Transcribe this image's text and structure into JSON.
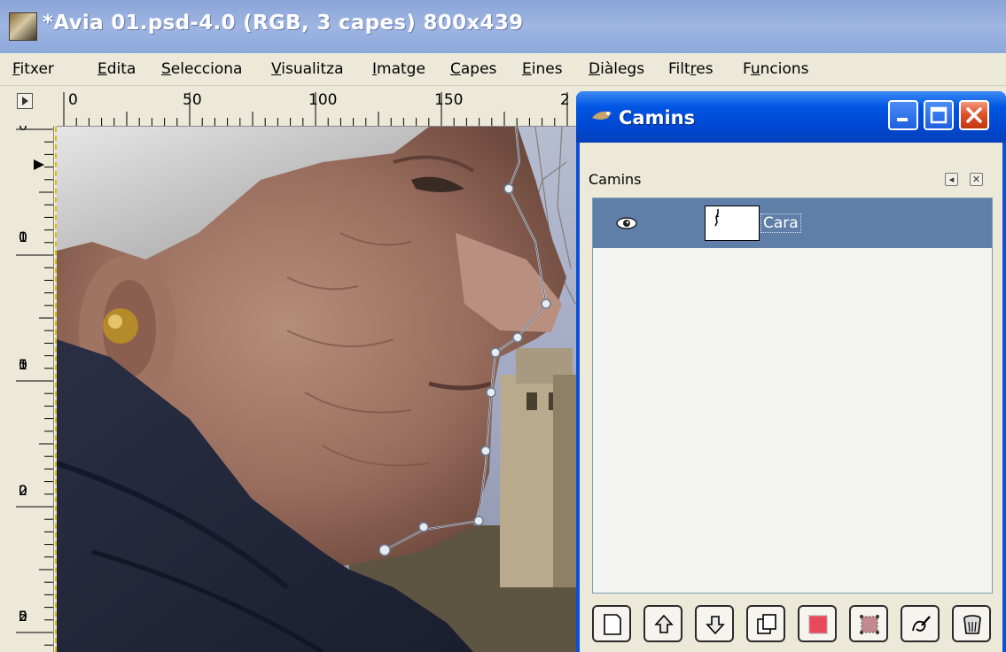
{
  "window": {
    "title": "*Avia 01.psd-4.0 (RGB, 3 capes) 800x439"
  },
  "menubar": {
    "items": [
      {
        "mnemonic": "F",
        "rest": "itxer"
      },
      {
        "mnemonic": "E",
        "rest": "dita"
      },
      {
        "mnemonic": "S",
        "rest": "elecciona"
      },
      {
        "mnemonic": "V",
        "rest": "isualitza"
      },
      {
        "mnemonic": "I",
        "rest": "matge"
      },
      {
        "mnemonic": "C",
        "rest": "apes"
      },
      {
        "mnemonic": "E",
        "rest": "ines"
      },
      {
        "mnemonic": "D",
        "rest": "iàlegs"
      },
      {
        "pre": "Filt",
        "mnemonic": "r",
        "rest": "es"
      },
      {
        "pre": "F",
        "mnemonic": "u",
        "rest": "ncions"
      }
    ]
  },
  "rulers": {
    "top_labels": [
      "0",
      "50",
      "100",
      "150",
      "2"
    ],
    "left_labels": [
      [
        "0"
      ],
      [
        "1",
        "0",
        "0"
      ],
      [
        "1",
        "5",
        "0"
      ],
      [
        "2",
        "0",
        "0"
      ],
      [
        "2",
        "5",
        "0"
      ]
    ]
  },
  "dialog": {
    "title": "Camins",
    "dock_label": "Camins",
    "paths": [
      {
        "name": "Cara",
        "visible": true
      }
    ],
    "buttons": [
      {
        "name": "new-path",
        "icon": "new-document-icon"
      },
      {
        "name": "raise-path",
        "icon": "arrow-up-icon"
      },
      {
        "name": "lower-path",
        "icon": "arrow-down-icon"
      },
      {
        "name": "duplicate-path",
        "icon": "duplicate-icon"
      },
      {
        "name": "path-to-selection",
        "icon": "path-to-selection-icon"
      },
      {
        "name": "selection-to-path",
        "icon": "selection-to-path-icon"
      },
      {
        "name": "stroke-path",
        "icon": "stroke-path-icon"
      },
      {
        "name": "delete-path",
        "icon": "trash-icon"
      }
    ]
  },
  "colors": {
    "xp_title_active": "#0054e3",
    "xp_title_inactive": "#9db3e0",
    "xp_close": "#e0532b",
    "selected_row": "#5f7ea8",
    "canvas_guide": "#d8c000"
  }
}
